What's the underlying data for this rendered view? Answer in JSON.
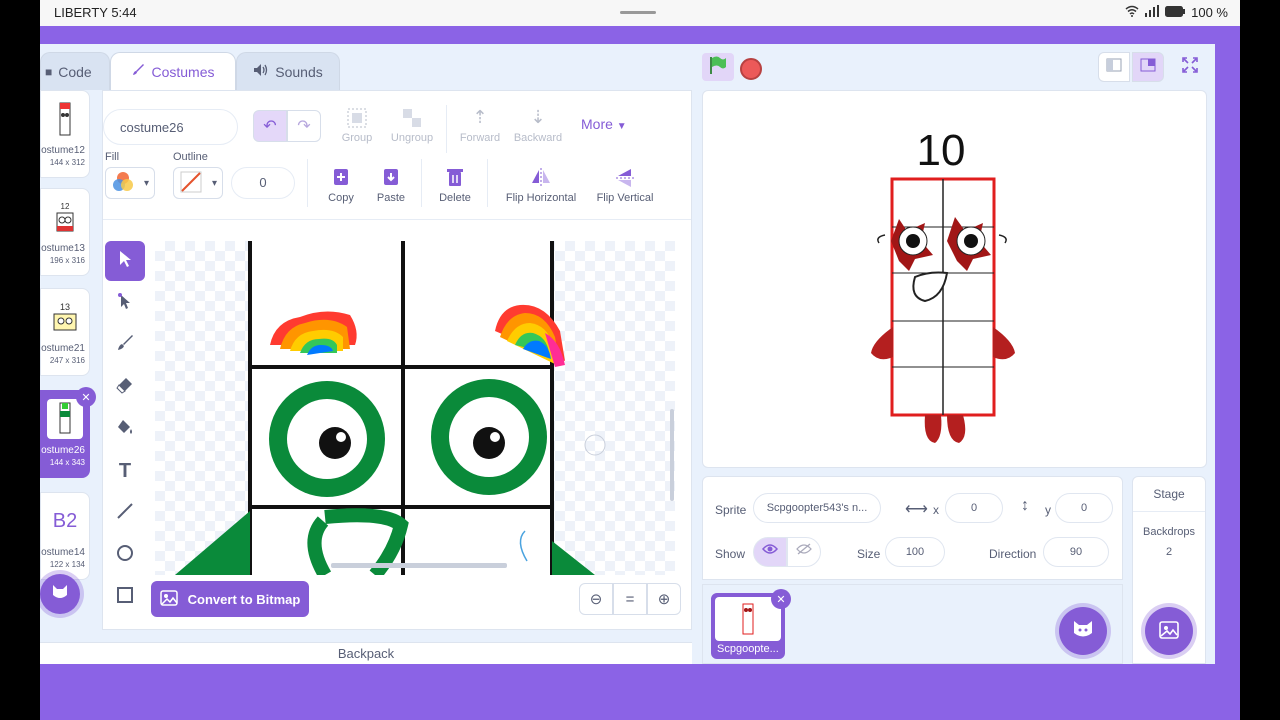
{
  "status_bar": {
    "carrier_time": "LIBERTY 5:44",
    "battery": "100 %"
  },
  "tabs": [
    {
      "label": "Code",
      "icon": "code-icon"
    },
    {
      "label": "Costumes",
      "icon": "brush-icon"
    },
    {
      "label": "Sounds",
      "icon": "speaker-icon"
    }
  ],
  "costumes": [
    {
      "name": "ostume12",
      "size": "144 x 312",
      "thumb_text": ""
    },
    {
      "name": "ostume13",
      "size": "196 x 316",
      "thumb_text": "12"
    },
    {
      "name": "ostume21",
      "size": "247 x 316",
      "thumb_text": "13"
    },
    {
      "name": "ostume26",
      "size": "144 x 343",
      "thumb_text": ""
    },
    {
      "name": "ostume14",
      "size": "122 x 134",
      "thumb_text": "B2"
    }
  ],
  "editor": {
    "costume_name": "costume26",
    "fill_label": "Fill",
    "outline_label": "Outline",
    "outline_width": "0",
    "group": "Group",
    "ungroup": "Ungroup",
    "forward": "Forward",
    "backward": "Backward",
    "more": "More",
    "copy": "Copy",
    "paste": "Paste",
    "delete": "Delete",
    "flip_horizontal": "Flip Horizontal",
    "flip_vertical": "Flip Vertical",
    "convert": "Convert to Bitmap",
    "zoom_reset": "="
  },
  "backpack": "Backpack",
  "stage_title_art": "10",
  "sprite": {
    "label": "Sprite",
    "name": "Scpgoopter543's n...",
    "x_label": "x",
    "x": "0",
    "y_label": "y",
    "y": "0",
    "show_label": "Show",
    "size_label": "Size",
    "size": "100",
    "direction_label": "Direction",
    "direction": "90",
    "thumb_name": "Scpgoopte..."
  },
  "stage_panel": {
    "title": "Stage",
    "backdrops_label": "Backdrops",
    "backdrops_count": "2"
  },
  "colors": {
    "accent": "#855cd6",
    "menubar": "#8b63e6",
    "workspace": "#e9f1fc",
    "green_flag": "#4cbf56",
    "stop": "#ec5959"
  }
}
